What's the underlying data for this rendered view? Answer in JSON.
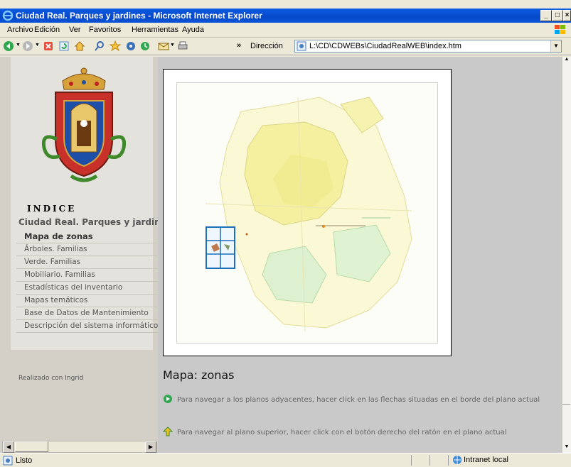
{
  "window": {
    "title": "Ciudad Real. Parques y jardines - Microsoft Internet Explorer"
  },
  "menu": [
    "Archivo",
    "Edición",
    "Ver",
    "Favoritos",
    "Herramientas",
    "Ayuda"
  ],
  "address": {
    "label": "Dirección",
    "url": "L:\\CD\\CDWEBs\\CiudadRealWEB\\index.htm"
  },
  "nav": {
    "heading": "INDICE",
    "section_title": "Ciudad Real. Parques y jardines",
    "items": [
      {
        "label": "Mapa de zonas",
        "active": true
      },
      {
        "label": "Árboles. Familias"
      },
      {
        "label": "Verde. Familias"
      },
      {
        "label": "Mobiliario. Familias"
      },
      {
        "label": "Estadísticas del inventario"
      },
      {
        "label": "Mapas temáticos"
      },
      {
        "label": "Base de Datos de Mantenimiento"
      },
      {
        "label": "Descripción del sistema informático"
      }
    ],
    "credit": "Realizado con Ingrid"
  },
  "main": {
    "title": "Mapa: zonas",
    "instruction1": "Para navegar a los planos adyacentes, hacer click en las flechas situadas en el borde del plano actual",
    "instruction2": "Para navegar al plano superior, hacer click con el botón derecho del ratón en el plano actual"
  },
  "status": {
    "text": "Listo",
    "zone": "Intranet local"
  },
  "colors": {
    "titlebar": "#0a5ce3",
    "map_yellow": "#f4f0a0",
    "map_green": "#c8ecc0",
    "selection_blue": "#1c6fb8"
  }
}
